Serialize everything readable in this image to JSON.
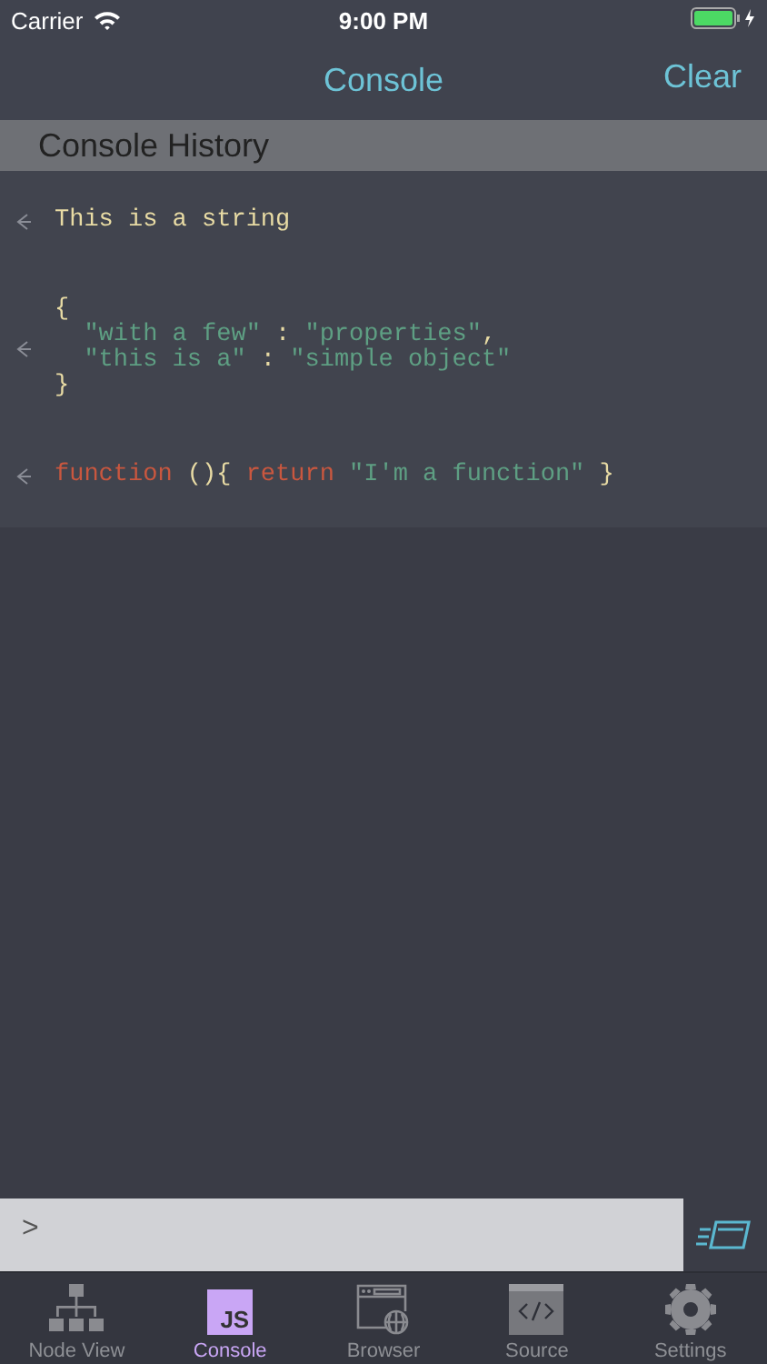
{
  "status_bar": {
    "carrier": "Carrier",
    "time": "9:00 PM",
    "charging": true
  },
  "nav_bar": {
    "title": "Console",
    "action": "Clear"
  },
  "section_header": "Console History",
  "console_entries": [
    {
      "lines": [
        [
          {
            "kind": "text",
            "text": "This is a string"
          }
        ]
      ]
    },
    {
      "lines": [
        [
          {
            "kind": "punct",
            "text": "{"
          }
        ],
        [
          {
            "kind": "string",
            "text": "  \"with a few\""
          },
          {
            "kind": "punct",
            "text": " : "
          },
          {
            "kind": "string",
            "text": "\"properties\""
          },
          {
            "kind": "punct",
            "text": ","
          }
        ],
        [
          {
            "kind": "string",
            "text": "  \"this is a\""
          },
          {
            "kind": "punct",
            "text": " : "
          },
          {
            "kind": "string",
            "text": "\"simple object\""
          }
        ],
        [
          {
            "kind": "punct",
            "text": "}"
          }
        ]
      ]
    },
    {
      "lines": [
        [
          {
            "kind": "keyword",
            "text": "function"
          },
          {
            "kind": "punct",
            "text": " (){ "
          },
          {
            "kind": "keyword",
            "text": "return"
          },
          {
            "kind": "string",
            "text": " \"I'm a function\""
          },
          {
            "kind": "punct",
            "text": " }"
          }
        ]
      ]
    }
  ],
  "input": {
    "prompt": ">"
  },
  "tabs": [
    {
      "label": "Node View",
      "kind": "tree",
      "selected": false
    },
    {
      "label": "Console",
      "kind": "js",
      "icon_text": "JS",
      "selected": true
    },
    {
      "label": "Browser",
      "kind": "browser",
      "selected": false
    },
    {
      "label": "Source",
      "kind": "source",
      "selected": false
    },
    {
      "label": "Settings",
      "kind": "gear",
      "selected": false
    }
  ]
}
